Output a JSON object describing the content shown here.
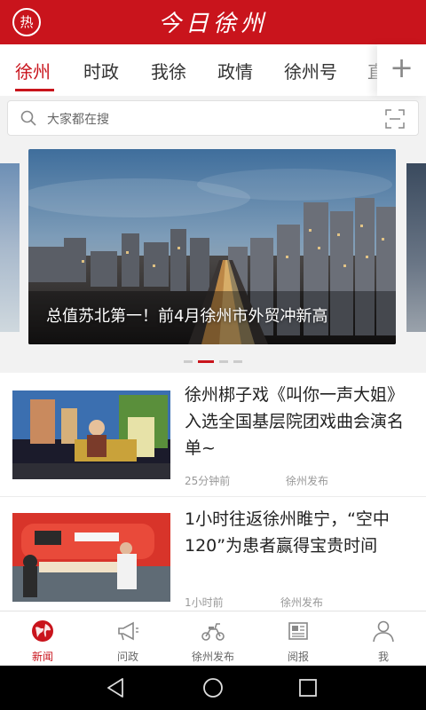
{
  "header": {
    "hot_label": "热",
    "app_title": "今日徐州"
  },
  "tabs": {
    "items": [
      {
        "label": "徐州"
      },
      {
        "label": "时政"
      },
      {
        "label": "我徐"
      },
      {
        "label": "政情"
      },
      {
        "label": "徐州号"
      },
      {
        "label": "直"
      }
    ],
    "active": "徐州",
    "add_icon": "plus-icon"
  },
  "search": {
    "placeholder": "大家都在搜",
    "icon": "search-icon",
    "scan_icon": "scan-icon"
  },
  "carousel": {
    "caption": "总值苏北第一！前4月徐州市外贸冲新高",
    "dots_count": 4,
    "active_dot": 1
  },
  "news": [
    {
      "title": "徐州梆子戏《叫你一声大姐》入选全国基层院团戏曲会演名单~",
      "time": "25分钟前",
      "source": "徐州发布"
    },
    {
      "title": "1小时往返徐州睢宁，“空中120”为患者赢得宝贵时间",
      "time": "1小时前",
      "source": "徐州发布"
    }
  ],
  "bottom_nav": [
    {
      "label": "新闻",
      "icon": "globe-icon",
      "active": true
    },
    {
      "label": "问政",
      "icon": "megaphone-icon",
      "active": false
    },
    {
      "label": "徐州发布",
      "icon": "scooter-icon",
      "active": false
    },
    {
      "label": "阅报",
      "icon": "newspaper-icon",
      "active": false
    },
    {
      "label": "我",
      "icon": "person-icon",
      "active": false
    }
  ],
  "colors": {
    "brand": "#c9141c",
    "text": "#222222",
    "muted": "#999999"
  }
}
